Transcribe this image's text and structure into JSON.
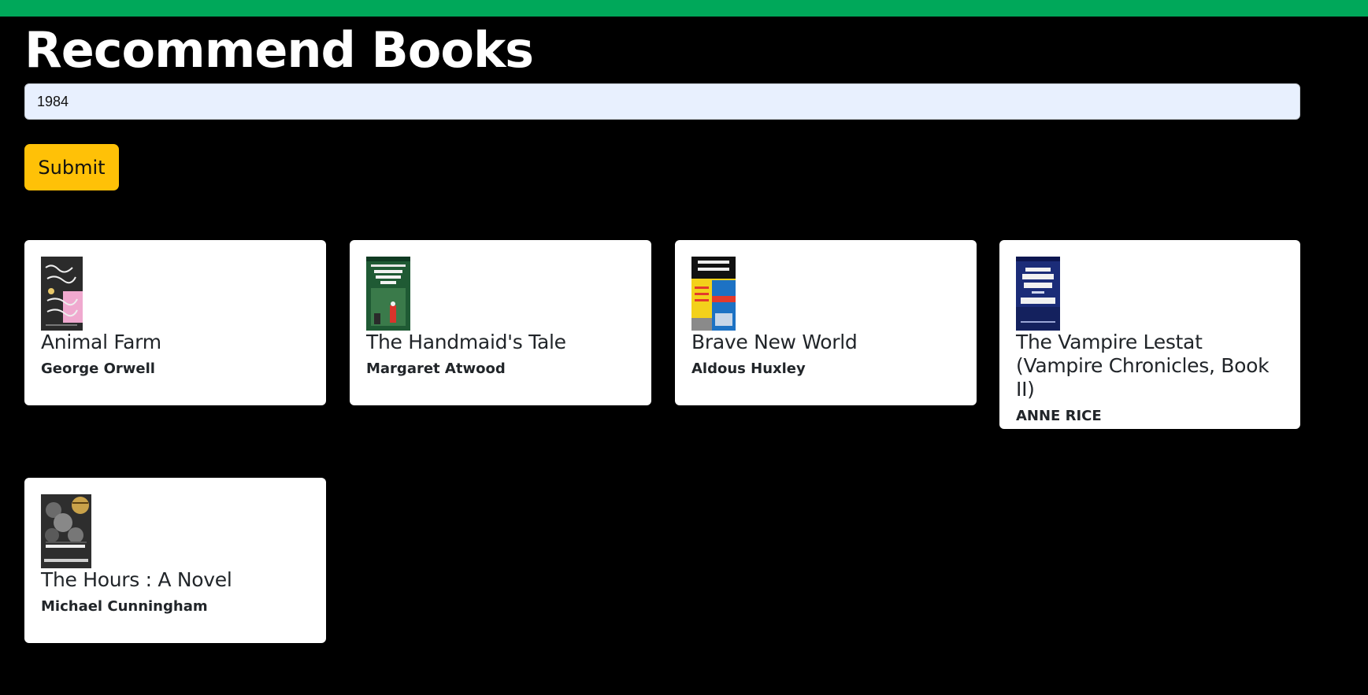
{
  "header": {
    "accent_color": "#00a85a",
    "title": "Recommend Books"
  },
  "search": {
    "value": "1984",
    "background": "#e8f0fe"
  },
  "submit": {
    "label": "Submit",
    "color": "#ffc107"
  },
  "results": [
    {
      "title": "Animal Farm",
      "author": "George Orwell",
      "cover_icon": "book-cover-animal-farm"
    },
    {
      "title": "The Handmaid's Tale",
      "author": "Margaret Atwood",
      "cover_icon": "book-cover-handmaids-tale"
    },
    {
      "title": "Brave New World",
      "author": "Aldous Huxley",
      "cover_icon": "book-cover-brave-new-world"
    },
    {
      "title": "The Vampire Lestat (Vampire Chronicles, Book II)",
      "author": "ANNE RICE",
      "cover_icon": "book-cover-vampire-lestat"
    },
    {
      "title": "The Hours : A Novel",
      "author": "Michael Cunningham",
      "cover_icon": "book-cover-the-hours"
    }
  ]
}
